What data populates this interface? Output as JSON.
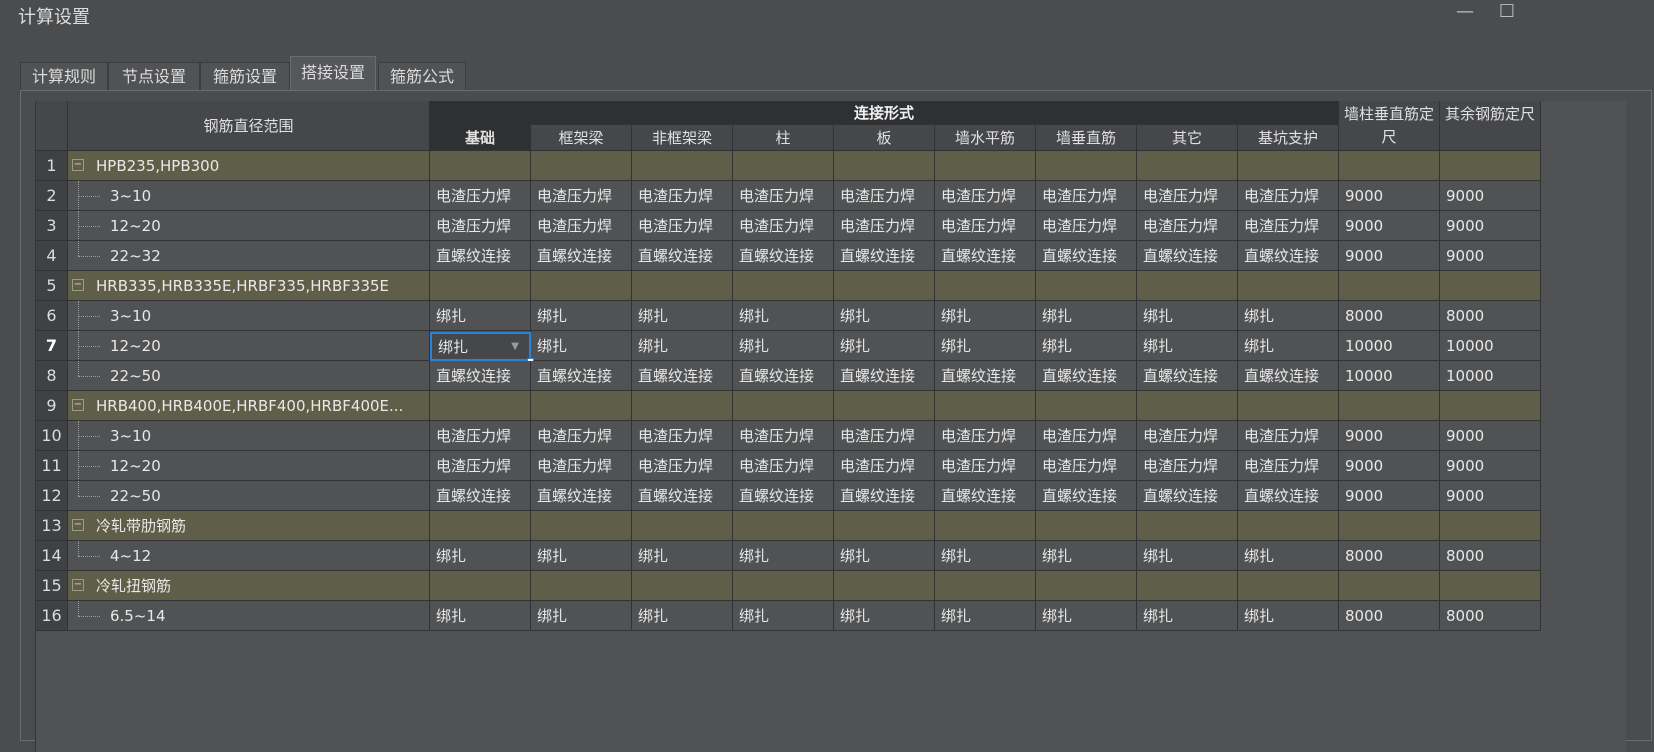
{
  "window": {
    "title": "计算设置"
  },
  "tabs": [
    "计算规则",
    "节点设置",
    "箍筋设置",
    "搭接设置",
    "箍筋公式"
  ],
  "active_tab": 3,
  "table": {
    "range_header": "钢筋直径范围",
    "conn_header": "连接形式",
    "conn_columns": [
      "基础",
      "框架梁",
      "非框架梁",
      "柱",
      "板",
      "墙水平筋",
      "墙垂直筋",
      "其它",
      "基坑支护"
    ],
    "extra_columns": [
      "墙柱垂直筋定尺",
      "其余钢筋定尺"
    ],
    "rows": [
      {
        "num": "1",
        "type": "group",
        "label": "HPB235,HPB300"
      },
      {
        "num": "2",
        "type": "item",
        "label": "3~10",
        "conn": "电渣压力焊",
        "len1": "9000",
        "len2": "9000"
      },
      {
        "num": "3",
        "type": "item",
        "label": "12~20",
        "conn": "电渣压力焊",
        "len1": "9000",
        "len2": "9000"
      },
      {
        "num": "4",
        "type": "item",
        "label": "22~32",
        "conn": "直螺纹连接",
        "len1": "9000",
        "len2": "9000",
        "last": true
      },
      {
        "num": "5",
        "type": "group",
        "label": "HRB335,HRB335E,HRBF335,HRBF335E"
      },
      {
        "num": "6",
        "type": "item",
        "label": "3~10",
        "conn": "绑扎",
        "len1": "8000",
        "len2": "8000"
      },
      {
        "num": "7",
        "type": "item",
        "label": "12~20",
        "conn": "绑扎",
        "len1": "10000",
        "len2": "10000",
        "selected": true
      },
      {
        "num": "8",
        "type": "item",
        "label": "22~50",
        "conn": "直螺纹连接",
        "len1": "10000",
        "len2": "10000",
        "last": true
      },
      {
        "num": "9",
        "type": "group",
        "label": "HRB400,HRB400E,HRBF400,HRBF400E..."
      },
      {
        "num": "10",
        "type": "item",
        "label": "3~10",
        "conn": "电渣压力焊",
        "len1": "9000",
        "len2": "9000"
      },
      {
        "num": "11",
        "type": "item",
        "label": "12~20",
        "conn": "电渣压力焊",
        "len1": "9000",
        "len2": "9000"
      },
      {
        "num": "12",
        "type": "item",
        "label": "22~50",
        "conn": "直螺纹连接",
        "len1": "9000",
        "len2": "9000",
        "last": true
      },
      {
        "num": "13",
        "type": "group",
        "label": "冷轧带肋钢筋"
      },
      {
        "num": "14",
        "type": "item",
        "label": "4~12",
        "conn": "绑扎",
        "len1": "8000",
        "len2": "8000",
        "last": true
      },
      {
        "num": "15",
        "type": "group",
        "label": "冷轧扭钢筋"
      },
      {
        "num": "16",
        "type": "item",
        "label": "6.5~14",
        "conn": "绑扎",
        "len1": "8000",
        "len2": "8000",
        "last": true
      }
    ]
  },
  "icons": {
    "collapse": "minus-box-icon",
    "minimize": "minimize-icon",
    "maximize": "maximize-icon",
    "dropdown": "dropdown-arrow-icon"
  },
  "colors": {
    "group_row": "#5f5e48",
    "selection": "#2a83d8"
  }
}
